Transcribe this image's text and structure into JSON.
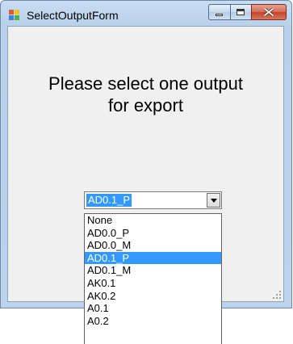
{
  "window": {
    "title": "SelectOutputForm",
    "caption_buttons": [
      "minimize-icon",
      "maximize-icon",
      "close-icon"
    ]
  },
  "prompt": {
    "line1": "Please select one output",
    "line2": "for export"
  },
  "combo": {
    "selected": "AD0.1_P"
  },
  "dropdown": {
    "items": [
      "None",
      "AD0.0_P",
      "AD0.0_M",
      "AD0.1_P",
      "AD0.1_M",
      "AK0.1",
      "AK0.2",
      "A0.1",
      "A0.2"
    ],
    "highlighted_index": 3
  },
  "colors": {
    "selection": "#3399ff",
    "client_bg": "#f0f0f0",
    "frame": "#bcd3ec",
    "close_button": "#c4432b"
  }
}
